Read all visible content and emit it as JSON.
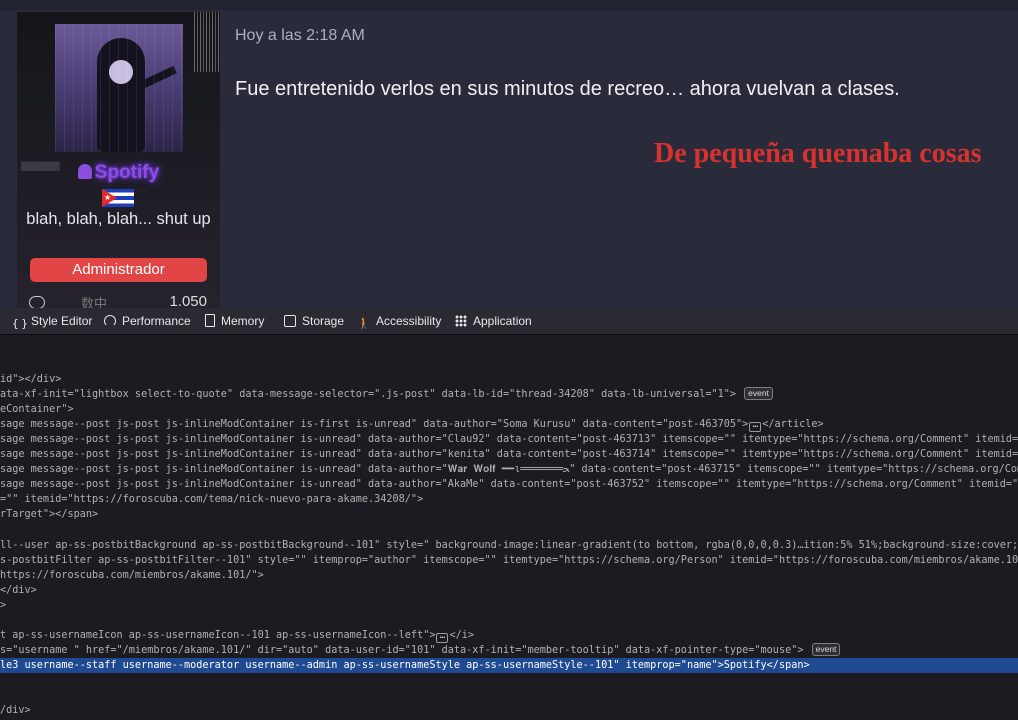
{
  "forum": {
    "username": "Spotify",
    "user_title": "blah, blah, blah... shut up",
    "role": "Administrador",
    "message_count": "1.050",
    "stat_glyph": "数中",
    "post_time": "Hoy a las 2:18 AM",
    "post_body": "Fue entretenido verlos en sus minutos de recreo… ahora vuelvan a clases.",
    "signature": "De pequeña quemaba cosas",
    "signature_color": "#d8322e",
    "username_color": "#8b4fe0",
    "role_color": "#e14545"
  },
  "devtools": {
    "tabs": [
      {
        "label": "Style Editor",
        "icon": "braces-icon"
      },
      {
        "label": "Performance",
        "icon": "gauge-icon"
      },
      {
        "label": "Memory",
        "icon": "memory-icon"
      },
      {
        "label": "Storage",
        "icon": "storage-icon"
      },
      {
        "label": "Accessibility",
        "icon": "accessibility-icon"
      },
      {
        "label": "Application",
        "icon": "application-grid-icon"
      }
    ],
    "event_badge": "event",
    "lines": [
      "id\"></div>",
      "ata-xf-init=\"lightbox select-to-quote\" data-message-selector=\".js-post\" data-lb-id=\"thread-34208\" data-lb-universal=\"1\">",
      "eContainer\">",
      "sage message--post js-post js-inlineModContainer is-first is-unread\" data-author=\"Soma Kurusu\" data-content=\"post-463705\">",
      "sage message--post js-post js-inlineModContainer is-unread\" data-author=\"Clau92\" data-content=\"post-463713\" itemscope=\"\" itemtype=\"https://schema.org/Comment\" itemid=\"https://foro",
      "sage message--post js-post js-inlineModContainer is-unread\" data-author=\"kenita\" data-content=\"post-463714\" itemscope=\"\" itemtype=\"https://schema.org/Comment\" itemid=\"https://foro",
      "sage message--post js-post js-inlineModContainer is-unread\" data-author=\"𝐖𝐚𝐫 𝐖𝐨𝐥𝐟 ━━ι═══════ﺤ\" data-content=\"post-463715\" itemscope=\"\" itemtype=\"https://schema.org/Comment\" itemi",
      "sage message--post js-post js-inlineModContainer is-unread\" data-author=\"AkaMe\" data-content=\"post-463752\" itemscope=\"\" itemtype=\"https://schema.org/Comment\" itemid=\"https://foros",
      "=\"\" itemid=\"https://foroscuba.com/tema/nick-nuevo-para-akame.34208/\">",
      "rTarget\"></span>",
      "",
      "ll--user ap-ss-postbitBackground ap-ss-postbitBackground--101\" style=\" background-image:linear-gradient(to bottom, rgba(0,0,0,0.3)…ition:5% 51%;background-size:cover;background-re",
      "s-postbitFilter ap-ss-postbitFilter--101\" style=\"\" itemprop=\"author\" itemscope=\"\" itemtype=\"https://schema.org/Person\" itemid=\"https://foroscuba.com/miembros/akame.101/\">",
      "https://foroscuba.com/miembros/akame.101/\">",
      "</div>",
      ">",
      "",
      "t ap-ss-usernameIcon ap-ss-usernameIcon--101 ap-ss-usernameIcon--left\">",
      "s=\"username \" href=\"/miembros/akame.101/\" dir=\"auto\" data-user-id=\"101\" data-xf-init=\"member-tooltip\" data-xf-pointer-type=\"mouse\">",
      "le3 username--staff username--moderator username--admin ap-ss-usernameStyle ap-ss-usernameStyle--101\" itemprop=\"name\">Spotify</span>",
      "",
      "/div>"
    ],
    "line_suffixes": {
      "3": "</article>",
      "17": "</i>"
    }
  }
}
